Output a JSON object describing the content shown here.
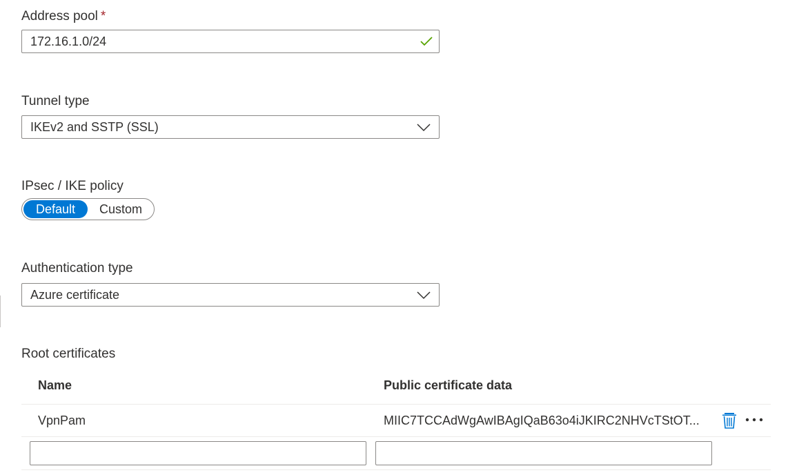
{
  "address_pool": {
    "label": "Address pool",
    "required_marker": "*",
    "value": "172.16.1.0/24",
    "valid_icon": "checkmark-icon"
  },
  "tunnel_type": {
    "label": "Tunnel type",
    "selected": "IKEv2 and SSTP (SSL)"
  },
  "ipsec_policy": {
    "label": "IPsec / IKE policy",
    "options": [
      "Default",
      "Custom"
    ],
    "selected": "Default"
  },
  "authentication_type": {
    "label": "Authentication type",
    "selected": "Azure certificate"
  },
  "root_certificates": {
    "label": "Root certificates",
    "columns": [
      "Name",
      "Public certificate data"
    ],
    "rows": [
      {
        "name": "VpnPam",
        "data": "MIIC7TCCAdWgAwIBAgIQaB63o4iJKIRC2NHVcTStOT..."
      }
    ],
    "new_row": {
      "name_value": "",
      "data_value": ""
    }
  },
  "colors": {
    "accent": "#0078d4",
    "valid": "#57a300",
    "required": "#a4262c",
    "text": "#323130",
    "border": "#8a8886"
  }
}
